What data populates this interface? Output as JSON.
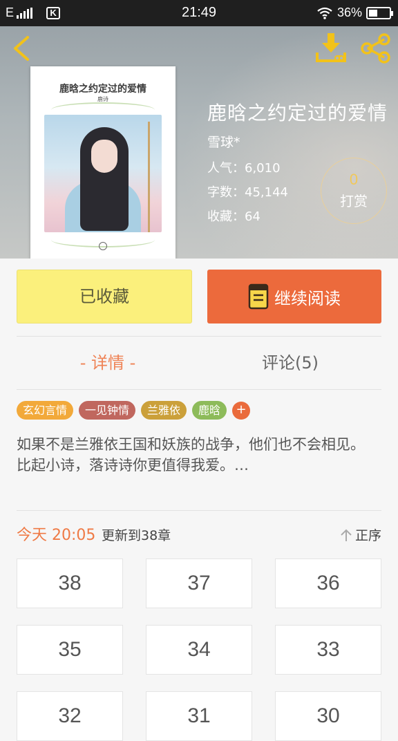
{
  "status_bar": {
    "network": "E",
    "app_badge": "K",
    "time": "21:49",
    "battery": "36%",
    "icons": [
      "signal-icon",
      "wifi-icon",
      "battery-charging-icon"
    ]
  },
  "header": {
    "icons": [
      "back-arrow-icon",
      "download-icon",
      "share-icon"
    ],
    "accent_color": "#f2c21a"
  },
  "cover": {
    "title": "鹿晗之约定过的爱情",
    "author": "鹿诗"
  },
  "book": {
    "title": "鹿晗之约定过的爱情",
    "author": "雪球*",
    "popularity": "人气：6,010",
    "word_count": "字数：45,144",
    "favorites": "收藏：64"
  },
  "tip": {
    "count": "0",
    "label": "打赏"
  },
  "actions": {
    "favorited_label": "已收藏",
    "continue_label": "继续阅读",
    "favorited_color": "#fbf07c",
    "continue_color": "#ec6a3c"
  },
  "tabs": [
    {
      "label": "- 详情 -",
      "active": true
    },
    {
      "label": "评论(5)",
      "active": false
    }
  ],
  "tags": [
    {
      "label": "玄幻言情",
      "color": "#f2a93a"
    },
    {
      "label": "一见钟情",
      "color": "#c0675e"
    },
    {
      "label": "兰雅依",
      "color": "#cba03a"
    },
    {
      "label": "鹿晗",
      "color": "#8dbb5a"
    }
  ],
  "tag_add_label": "+",
  "description": {
    "line1": "如果不是兰雅依王国和妖族的战争，他们也不会相见。",
    "line2": "比起小诗，落诗诗你更值得我爱。…"
  },
  "update": {
    "time": "今天 20:05",
    "text": "更新到38章",
    "sort_label": "正序"
  },
  "chapters": [
    "38",
    "37",
    "36",
    "35",
    "34",
    "33",
    "32",
    "31",
    "30"
  ]
}
